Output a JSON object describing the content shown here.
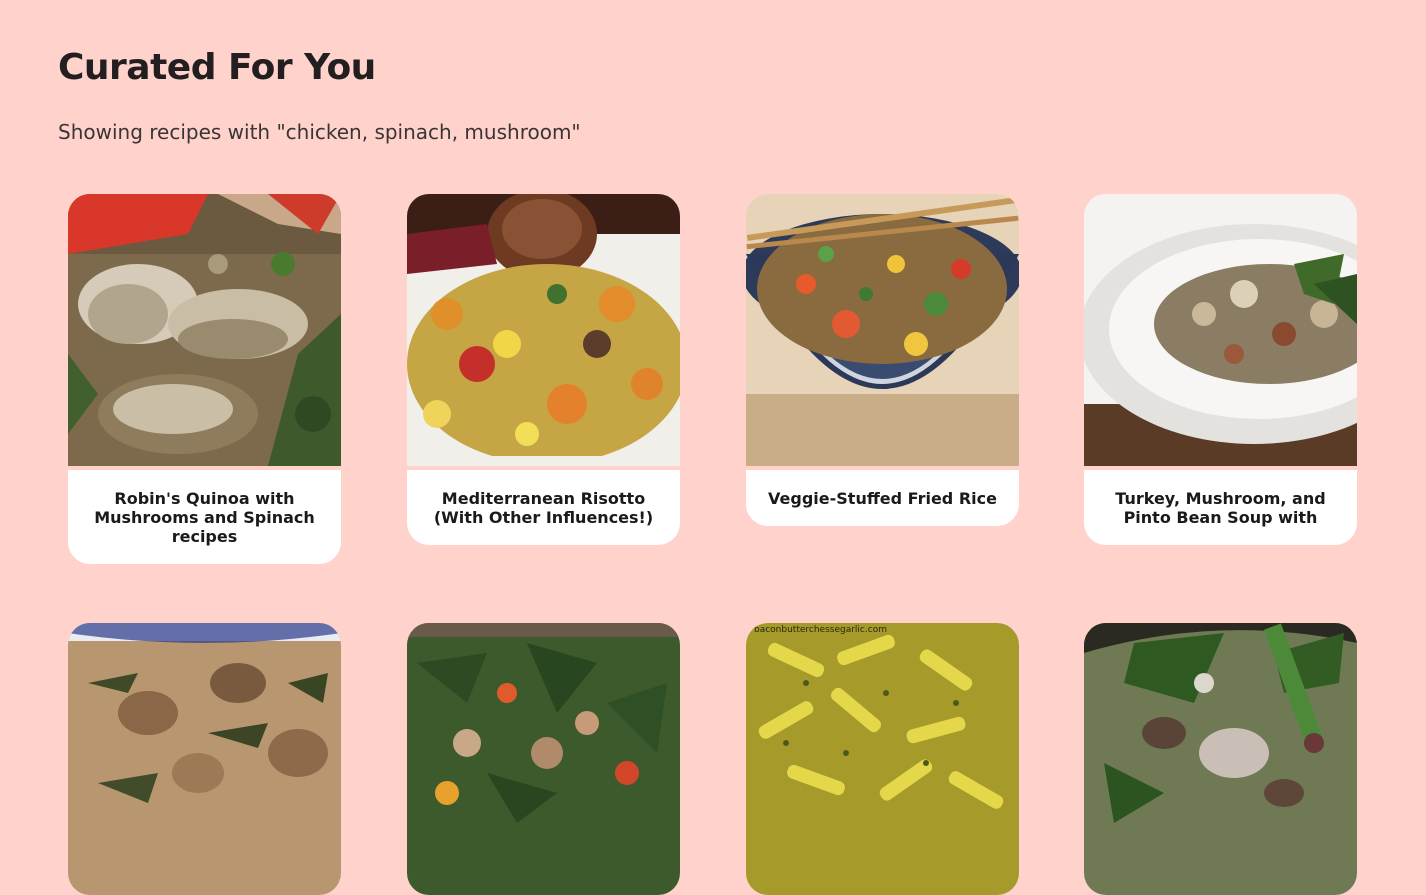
{
  "header": {
    "title": "Curated For You",
    "subtitle": "Showing recipes with \"chicken, spinach, mushroom\""
  },
  "recipes": [
    {
      "title": "Robin's Quinoa with Mushrooms and Spinach recipes",
      "image": "quinoa-mushroom-photo"
    },
    {
      "title": "Mediterranean Risotto (With Other Influences!)",
      "image": "risotto-photo"
    },
    {
      "title": "Veggie-Stuffed Fried Rice",
      "image": "fried-rice-bowl-photo"
    },
    {
      "title": "Turkey, Mushroom, and Pinto Bean Soup with",
      "image": "bean-soup-photo"
    },
    {
      "title": "",
      "image": "creamy-mushroom-chicken-photo"
    },
    {
      "title": "",
      "image": "spinach-stir-fry-photo"
    },
    {
      "title": "",
      "image": "penne-pesto-photo",
      "watermark": "baconbutterchessegarlic.com"
    },
    {
      "title": "",
      "image": "spinach-soup-photo"
    }
  ],
  "colors": {
    "background": "#ffd3cc",
    "card": "#ffffff",
    "title": "#231f20"
  }
}
